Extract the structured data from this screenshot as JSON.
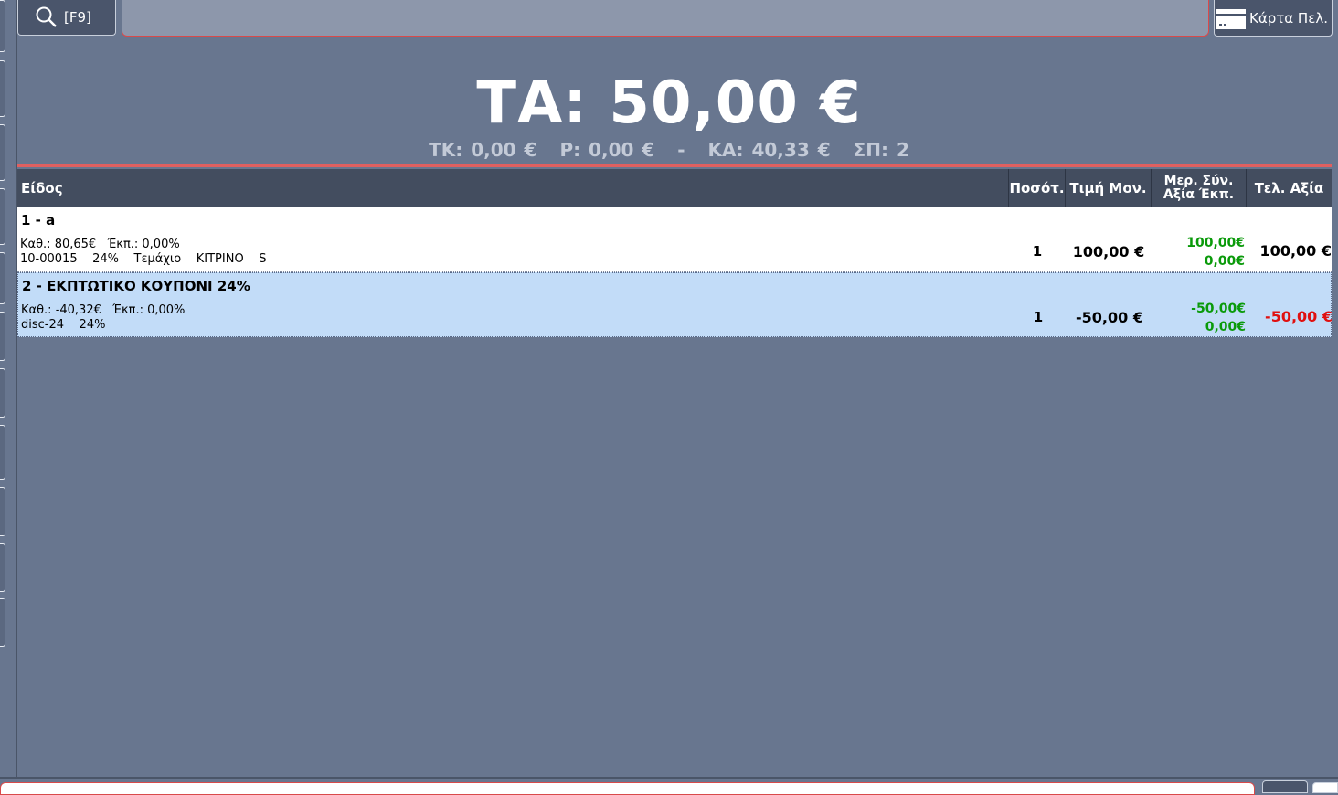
{
  "toolbar": {
    "search_label": "[F9]",
    "search_value": "",
    "card_label": "Κάρτα Πελ."
  },
  "totals": {
    "main": "ΤΑ: 50,00 €",
    "tk": "ΤΚ: 0,00 €",
    "r": "Ρ: 0,00 €",
    "sep": "-",
    "ka": "ΚΑ: 40,33 €",
    "sp": "ΣΠ: 2"
  },
  "columns": {
    "item": "Είδος",
    "qty": "Ποσότ.",
    "unit_price": "Τιμή Μον.",
    "discount_line1": "Μερ. Σύν.",
    "discount_line2": "Αξία  Έκπ.",
    "final": "Τελ. Αξία"
  },
  "rows": [
    {
      "title": "1 - a",
      "meta1": "Καθ.: 80,65€   Έκπ.: 0,00%",
      "meta2": "10-00015    24%    Τεμάχιο    ΚΙΤΡΙΝΟ    S",
      "qty": "1",
      "unit_price": "100,00 €",
      "discount_value": "100,00€",
      "discount_amount": "0,00€",
      "final": "100,00 €",
      "final_color": "#000000"
    },
    {
      "title": "2 - ΕΚΠΤΩΤΙΚΟ ΚΟΥΠΟΝΙ 24%",
      "meta1": "Καθ.: -40,32€   Έκπ.: 0,00%",
      "meta2": "disc-24    24%",
      "qty": "1",
      "unit_price": "-50,00 €",
      "discount_value": "-50,00€",
      "discount_amount": "0,00€",
      "final": "-50,00 €",
      "final_color": "#e01010"
    }
  ],
  "colors": {
    "background": "#68768f",
    "accent_red": "#e06060",
    "discount_green": "#0a9a0a",
    "selected_row": "#c2dcf8"
  },
  "icons": {
    "search": "search-icon",
    "card": "customer-card-icon"
  }
}
